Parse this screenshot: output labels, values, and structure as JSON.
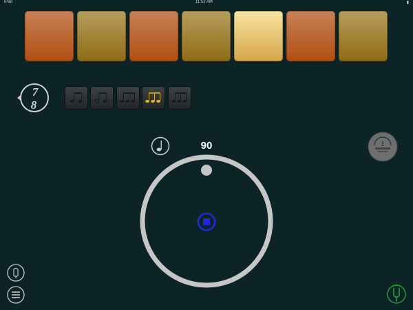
{
  "status_bar": {
    "carrier": "iPad",
    "time": "11:52 AM",
    "battery": ""
  },
  "beats": [
    {
      "state": "orange"
    },
    {
      "state": "gold"
    },
    {
      "state": "orange"
    },
    {
      "state": "gold"
    },
    {
      "state": "light"
    },
    {
      "state": "orange"
    },
    {
      "state": "gold"
    }
  ],
  "time_signature": {
    "numerator": "7",
    "denominator": "8"
  },
  "subdivisions": [
    {
      "id": "dotted-eighths",
      "active": false
    },
    {
      "id": "quarter-eighth",
      "active": false
    },
    {
      "id": "three-eighths",
      "active": false
    },
    {
      "id": "triplet",
      "active": true
    },
    {
      "id": "eighths-dotted",
      "active": false
    }
  ],
  "tempo": {
    "value": "90"
  },
  "colors": {
    "background": "#0d2426",
    "active_note": "#e0b81f",
    "dial_ring": "#c6c6c6",
    "play_blue": "#1f2ad8",
    "tuner_green": "#2fa43a"
  },
  "icons": {
    "tempo": "quarter-note-icon",
    "logo": "app-logo-icon",
    "speaker": "speaker-icon",
    "menu": "menu-icon",
    "tuning_fork": "tuning-fork-icon"
  }
}
